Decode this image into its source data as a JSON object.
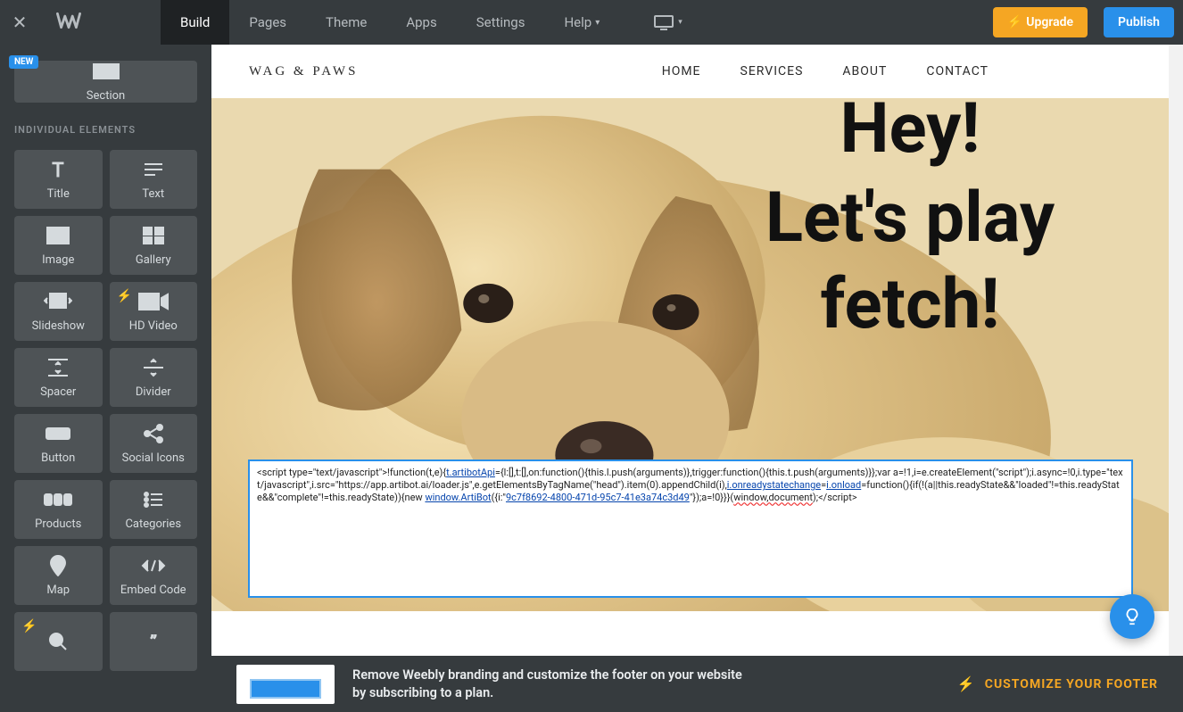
{
  "topbar": {
    "tabs": {
      "build": "Build",
      "pages": "Pages",
      "theme": "Theme",
      "apps": "Apps",
      "settings": "Settings",
      "help": "Help"
    },
    "upgrade": "Upgrade",
    "publish": "Publish"
  },
  "sidebar": {
    "new_badge": "NEW",
    "section": "Section",
    "heading": "INDIVIDUAL ELEMENTS",
    "tiles": {
      "title": "Title",
      "text": "Text",
      "image": "Image",
      "gallery": "Gallery",
      "slideshow": "Slideshow",
      "hdvideo": "HD Video",
      "spacer": "Spacer",
      "divider": "Divider",
      "button": "Button",
      "socialicons": "Social Icons",
      "products": "Products",
      "categories": "Categories",
      "map": "Map",
      "embedcode": "Embed Code"
    }
  },
  "site": {
    "logo": "WAG & PAWS",
    "nav": {
      "home": "HOME",
      "services": "SERVICES",
      "about": "ABOUT",
      "contact": "CONTACT"
    },
    "hero": {
      "l1": "Hey!",
      "l2": "Let's play",
      "l3": "fetch!"
    },
    "embed_prefix": "<script type=\"text/javascript\">!function(t,e){",
    "embed_t1": "t.artibotApi",
    "embed_t2": "={l:[],t:[],on:function(){this.l.push(arguments)},trigger:function(){this.t.push(arguments)}};var a=!1,i=e.createElement(\"script\");i.async=!0,i.type=\"text/javascript\",i.src=\"https://app.artibot.ai/loader.js\",e.getElementsByTagName(\"head\").item(0).appendChild(i),",
    "embed_t3": "i.onreadystatechange",
    "embed_t4": "=",
    "embed_t5": "i.onload",
    "embed_t6": "=function(){if(!(a||this.readyState&&\"loaded\"!=this.readyState&&\"complete\"!=this.readyState)){new ",
    "embed_t7": "window.ArtiBot",
    "embed_t8": "({i:\"",
    "embed_t9": "9c7f8692-4800-471d-95c7-41e3a74c3d49",
    "embed_t10": "\"});a=!0}}}(",
    "embed_t11": "window,document",
    "embed_suffix": ");</script>"
  },
  "footer": {
    "text": "Remove Weebly branding and customize the footer on your website by subscribing to a plan.",
    "cta": "CUSTOMIZE YOUR FOOTER"
  }
}
